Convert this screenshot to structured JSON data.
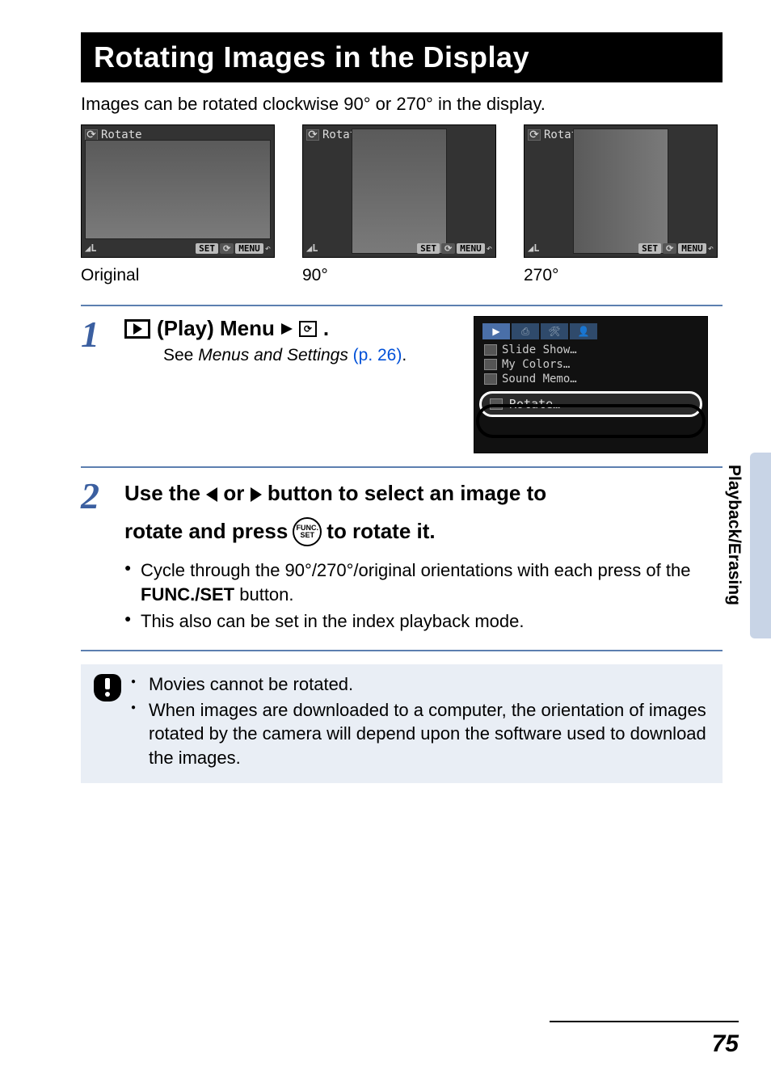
{
  "title": "Rotating Images in the Display",
  "intro": "Images can be rotated clockwise 90° or 270° in the display.",
  "shot_label": "Rotate",
  "shot_footer": {
    "set": "SET",
    "menu": "MENU"
  },
  "captions": [
    "Original",
    "90°",
    "270°"
  ],
  "step1": {
    "num": "1",
    "head_text": " (Play) Menu",
    "head_trail": ".",
    "sub_prefix": "See ",
    "sub_italic": "Menus and Settings",
    "sub_link": " (p. 26)",
    "sub_suffix": "."
  },
  "menu": {
    "items": [
      "Slide Show…",
      "My Colors…",
      "Sound Memo…"
    ],
    "highlight": "Rotate…"
  },
  "step2": {
    "num": "2",
    "line1a": "Use the ",
    "line1b": " or ",
    "line1c": " button to select an image to",
    "line2a": "rotate and press ",
    "line2b": " to rotate it.",
    "func_top": "FUNC.",
    "func_bot": "SET",
    "bullet1a": "Cycle through the 90°/270°/original orientations with each press of the ",
    "bullet1b": "FUNC./SET",
    "bullet1c": " button.",
    "bullet2": "This also can be set in the index playback mode."
  },
  "notes": [
    "Movies cannot be rotated.",
    "When images are downloaded to a computer, the orientation of images rotated by the camera will depend upon the software used to download the images."
  ],
  "side_tab": "Playback/Erasing",
  "page_number": "75"
}
